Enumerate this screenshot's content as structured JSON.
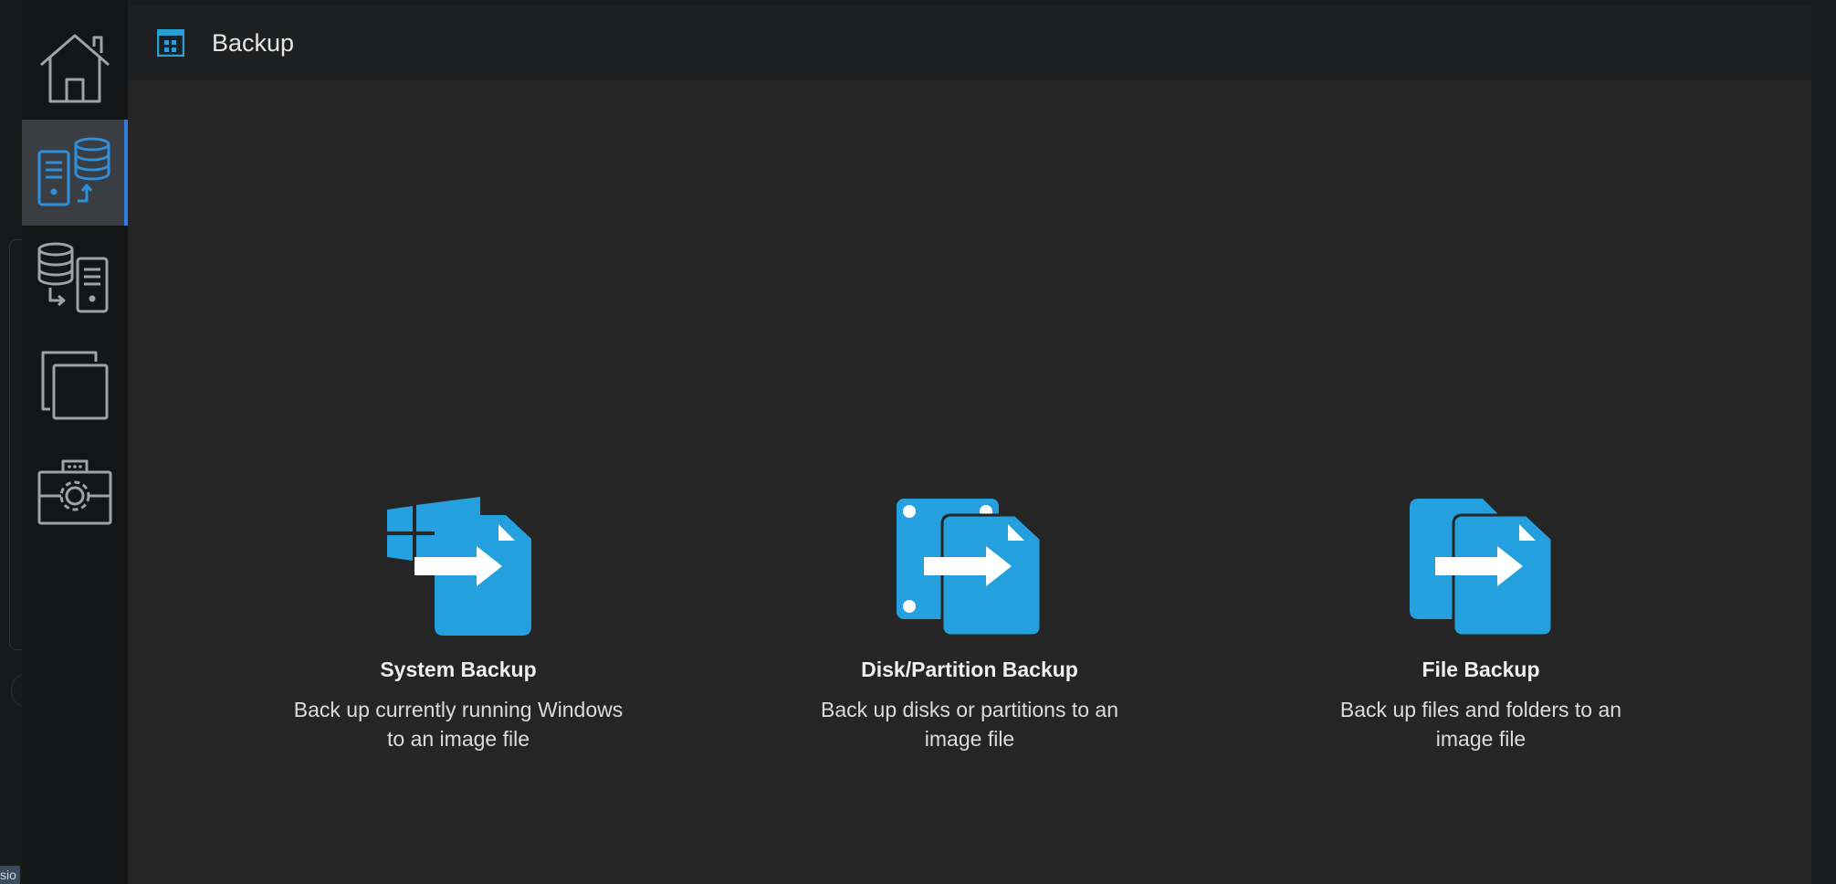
{
  "header": {
    "title": "Backup"
  },
  "sidebar": {
    "items": [
      {
        "id": "home",
        "icon": "home-icon",
        "active": false
      },
      {
        "id": "backup",
        "icon": "backup-icon",
        "active": true
      },
      {
        "id": "restore",
        "icon": "restore-icon",
        "active": false
      },
      {
        "id": "clone",
        "icon": "clone-icon",
        "active": false
      },
      {
        "id": "tools",
        "icon": "toolbox-icon",
        "active": false
      }
    ]
  },
  "cards": [
    {
      "title": "System Backup",
      "desc1": "Back up currently running Windows",
      "desc2": "to an image file",
      "icon": "system-backup-icon"
    },
    {
      "title": "Disk/Partition Backup",
      "desc1": "Back up disks or partitions to an",
      "desc2": "image file",
      "icon": "disk-backup-icon"
    },
    {
      "title": "File Backup",
      "desc1": "Back up files and folders to an",
      "desc2": "image file",
      "icon": "file-backup-icon"
    }
  ],
  "background_window": {
    "tag_text": "sio"
  },
  "colors": {
    "accent": "#2e7de0",
    "icon_blue": "#24a0de",
    "sidebar_bg": "#141517",
    "panel_bg": "#252526"
  }
}
